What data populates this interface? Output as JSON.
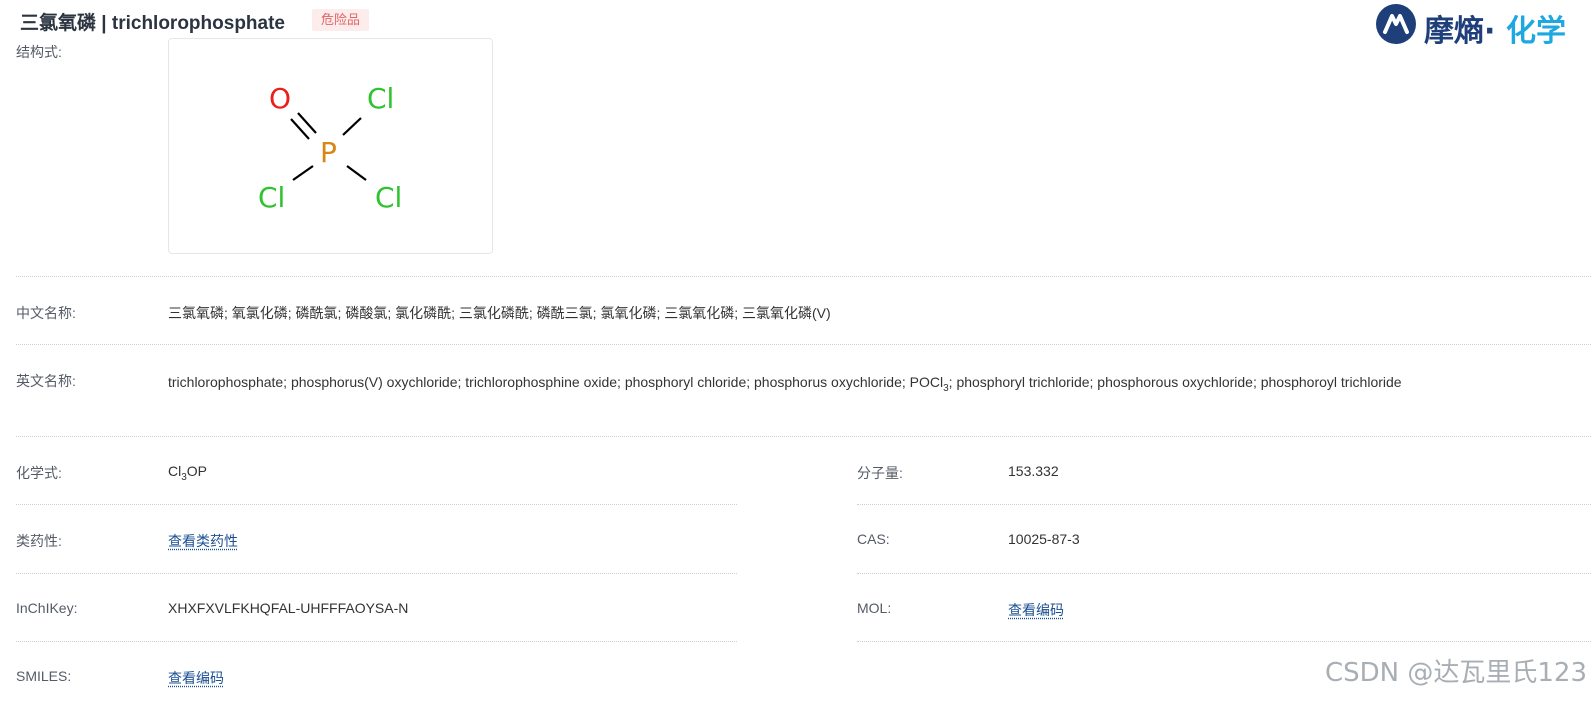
{
  "header": {
    "title": "三氯氧磷 | trichlorophosphate",
    "badge": "危险品",
    "logo_text_a": "摩熵·",
    "logo_text_b": "化学"
  },
  "structure": {
    "label": "结构式:",
    "atoms": {
      "o": "O",
      "p": "P",
      "cl": "Cl"
    },
    "colors": {
      "oxygen": "#e8211e",
      "phosphorus": "#d98714",
      "chlorine": "#2fc32f"
    }
  },
  "chinese_names": {
    "label": "中文名称:",
    "value": "三氯氧磷; 氧氯化磷; 磷酰氯; 磷酸氯; 氯化磷酰; 三氯化磷酰; 磷酰三氯; 氯氧化磷; 三氯氧化磷; 三氯氧化磷(V)"
  },
  "english_names": {
    "label": "英文名称:",
    "value_part1": "trichlorophosphate; phosphorus(V) oxychloride; trichlorophosphine oxide; phosphoryl chloride; phosphorus oxychloride; POCl",
    "value_sub": "3",
    "value_part2": "; phosphoryl trichloride; phosphorous oxychloride; phosphoroyl trichloride"
  },
  "formula": {
    "label": "化学式:",
    "value_a": "Cl",
    "value_sub": "3",
    "value_b": "OP"
  },
  "molecular_weight": {
    "label": "分子量:",
    "value": "153.332"
  },
  "drug_likeness": {
    "label": "类药性:",
    "link": "查看类药性"
  },
  "cas": {
    "label": "CAS:",
    "value": "10025-87-3"
  },
  "inchikey": {
    "label": "InChIKey:",
    "value": "XHXFXVLFKHQFAL-UHFFFAOYSA-N"
  },
  "mol": {
    "label": "MOL:",
    "link": "查看编码"
  },
  "smiles": {
    "label": "SMILES:",
    "link": "查看编码"
  },
  "watermark": "CSDN @达瓦里氏123",
  "colors": {
    "link": "#1b4f93",
    "brand_dark": "#1f3f7a",
    "brand_light": "#1ea7e0",
    "badge_bg": "#fdecec",
    "badge_text": "#e06666"
  }
}
